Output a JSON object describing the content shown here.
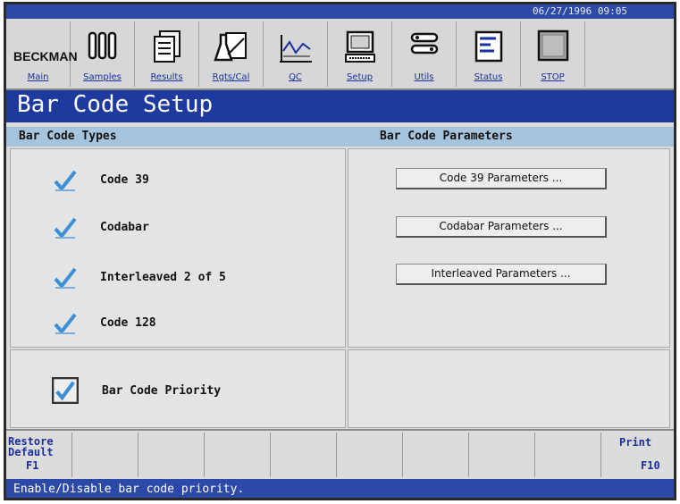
{
  "titlebar": {
    "datetime": "06/27/1996 09:05"
  },
  "toolbar": {
    "brand": "BECKMAN",
    "items": [
      {
        "label": "Main",
        "icon": "beckman-logo"
      },
      {
        "label": "Samples",
        "icon": "test-tubes-icon"
      },
      {
        "label": "Results",
        "icon": "results-stack-icon"
      },
      {
        "label": "Rgts/Cal",
        "icon": "reagent-flask-icon"
      },
      {
        "label": "QC",
        "icon": "qc-graph-icon"
      },
      {
        "label": "Setup",
        "icon": "computer-icon"
      },
      {
        "label": "Utils",
        "icon": "wrench-icon"
      },
      {
        "label": "Status",
        "icon": "status-document-icon"
      },
      {
        "label": "STOP",
        "icon": "stop-button-icon"
      }
    ]
  },
  "page_title": "Bar Code Setup",
  "sections": {
    "types_title": "Bar Code Types",
    "params_title": "Bar Code Parameters"
  },
  "types": [
    {
      "label": "Code 39",
      "checked": true
    },
    {
      "label": "Codabar",
      "checked": true
    },
    {
      "label": "Interleaved 2 of 5",
      "checked": true
    },
    {
      "label": "Code 128",
      "checked": true
    }
  ],
  "params": [
    {
      "label": "Code 39 Parameters ..."
    },
    {
      "label": "Codabar Parameters ..."
    },
    {
      "label": "Interleaved Parameters ..."
    }
  ],
  "priority": {
    "label": "Bar Code Priority",
    "checked": true
  },
  "fkeys": {
    "f1_line1": "Restore",
    "f1_line2": "Default",
    "f1_key": "F1",
    "f10_label": "Print",
    "f10_key": "F10"
  },
  "status_message": "Enable/Disable bar code priority.",
  "colors": {
    "title_blue": "#1f3a9e",
    "section_blue": "#a7c4dd",
    "check_blue": "#3b8fd6"
  }
}
